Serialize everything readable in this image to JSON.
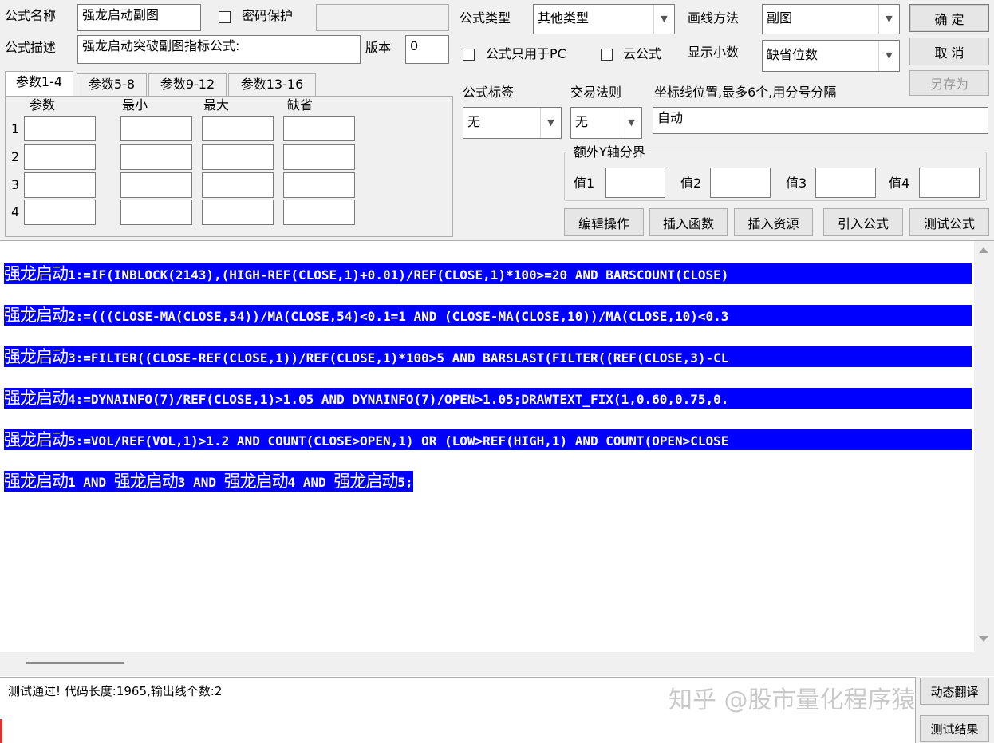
{
  "top": {
    "name_label": "公式名称",
    "name_value": "强龙启动副图",
    "password_label": "密码保护",
    "desc_label": "公式描述",
    "desc_value": "强龙启动突破副图指标公式:",
    "version_label": "版本",
    "version_value": "0",
    "type_label": "公式类型",
    "type_value": "其他类型",
    "draw_label": "画线方法",
    "draw_value": "副图",
    "pc_only_label": "公式只用于PC",
    "cloud_label": "云公式",
    "decimals_label": "显示小数",
    "decimals_value": "缺省位数",
    "ok_button": "确 定",
    "cancel_button": "取 消",
    "saveas_button": "另存为"
  },
  "tabs": [
    "参数1-4",
    "参数5-8",
    "参数9-12",
    "参数13-16"
  ],
  "params": {
    "headers": [
      "参数",
      "最小",
      "最大",
      "缺省"
    ],
    "rows": [
      "1",
      "2",
      "3",
      "4"
    ]
  },
  "mid": {
    "tag_label": "公式标签",
    "tag_value": "无",
    "trade_label": "交易法则",
    "trade_value": "无",
    "axis_label": "坐标线位置,最多6个,用分号分隔",
    "axis_value": "自动",
    "yaxis_group": "额外Y轴分界",
    "val1": "值1",
    "val2": "值2",
    "val3": "值3",
    "val4": "值4"
  },
  "buttons": {
    "edit": "编辑操作",
    "insert_func": "插入函数",
    "insert_res": "插入资源",
    "import": "引入公式",
    "test": "测试公式"
  },
  "code": [
    {
      "cn": "强龙启动",
      "rest": "1:=IF(INBLOCK(2143),(HIGH-REF(CLOSE,1)+0.01)/REF(CLOSE,1)*100>=20 AND BARSCOUNT(CLOSE)"
    },
    {
      "cn": "强龙启动",
      "rest": "2:=(((CLOSE-MA(CLOSE,54))/MA(CLOSE,54)<0.1=1 AND (CLOSE-MA(CLOSE,10))/MA(CLOSE,10)<0.3"
    },
    {
      "cn": "强龙启动",
      "rest": "3:=FILTER((CLOSE-REF(CLOSE,1))/REF(CLOSE,1)*100>5 AND BARSLAST(FILTER((REF(CLOSE,3)-CL"
    },
    {
      "cn": "强龙启动",
      "rest": "4:=DYNAINFO(7)/REF(CLOSE,1)>1.05 AND DYNAINFO(7)/OPEN>1.05;DRAWTEXT_FIX(1,0.60,0.75,0."
    },
    {
      "cn": "强龙启动",
      "rest": "5:=VOL/REF(VOL,1)>1.2 AND COUNT(CLOSE>OPEN,1) OR (LOW>REF(HIGH,1) AND COUNT(OPEN>CLOSE"
    }
  ],
  "code_last": {
    "p1": "强龙启动",
    "t1": "1 AND ",
    "p2": "强龙启动",
    "t2": "3 AND ",
    "p3": "强龙启动",
    "t3": "4 AND ",
    "p4": "强龙启动",
    "t4": "5;"
  },
  "status": {
    "message": "测试通过! 代码长度:1965,输出线个数:2",
    "dynamic_translate": "动态翻译",
    "test_result": "测试结果",
    "watermark": "知乎 @股市量化程序猿"
  }
}
